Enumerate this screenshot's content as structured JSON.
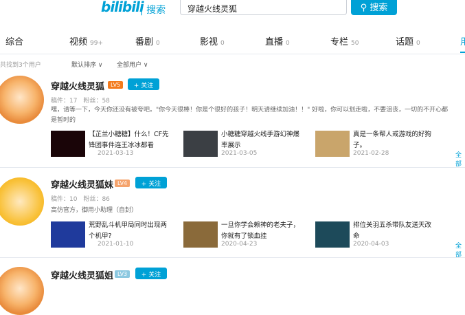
{
  "header": {
    "logo": "bilibili",
    "logo_sub": "| 搜索",
    "search_value": "穿越火线灵狐",
    "search_button": "搜索"
  },
  "tabs": [
    {
      "label": "综合",
      "count": ""
    },
    {
      "label": "视频",
      "count": "99+"
    },
    {
      "label": "番剧",
      "count": "0"
    },
    {
      "label": "影视",
      "count": "0"
    },
    {
      "label": "直播",
      "count": "0"
    },
    {
      "label": "专栏",
      "count": "50"
    },
    {
      "label": "话题",
      "count": "0"
    },
    {
      "label": "用",
      "count": ""
    }
  ],
  "filters": {
    "found": "共找到3个用户",
    "sort": "默认排序 ∨",
    "type": "全部用户 ∨"
  },
  "users": [
    {
      "name": "穿越火线灵狐",
      "level": "LV5",
      "follow": "+ 关注",
      "stats": "稿件：17　粉丝：58",
      "desc": "嘿，请等一下，今天你还没有被夸吧。\"你今天很棒！你是个很好的孩子！明天请继续加油！！\" 好啦，你可以划走啦，不要沮丧，一切的不开心都是暂时的",
      "videos": [
        {
          "title": "【芷兰小糖糖】什么！CF先锋团事件连王冰冰都看",
          "date": "2021-03-13"
        },
        {
          "title": "小糖糖穿越火线手游幻神爆率展示",
          "date": "2021-03-05"
        },
        {
          "title": "真是一条帮人戒游戏的好狗子。",
          "date": "2021-02-28"
        }
      ],
      "more": "全部"
    },
    {
      "name": "穿越火线灵狐妹",
      "level": "LV4",
      "follow": "+ 关注",
      "stats": "稿件：10　粉丝：86",
      "desc": "高仿官方，御用小助理（自封）",
      "videos": [
        {
          "title": "荒野乱斗机甲局同时出现两个机甲?",
          "date": "2021-01-10"
        },
        {
          "title": "一旦你学会赖神的老夫子，你就有了锁血挂",
          "date": "2020-04-23"
        },
        {
          "title": "排位关羽五杀带队友送天改命",
          "date": "2020-04-03"
        }
      ],
      "more": "全部"
    },
    {
      "name": "穿越火线灵狐姐",
      "level": "LV3",
      "follow": "+ 关注"
    }
  ],
  "colors": {
    "accent": "#00a1d6",
    "lv5": "#f37b1d",
    "lv4": "#f5a36c",
    "lv3": "#8cc8e0"
  }
}
